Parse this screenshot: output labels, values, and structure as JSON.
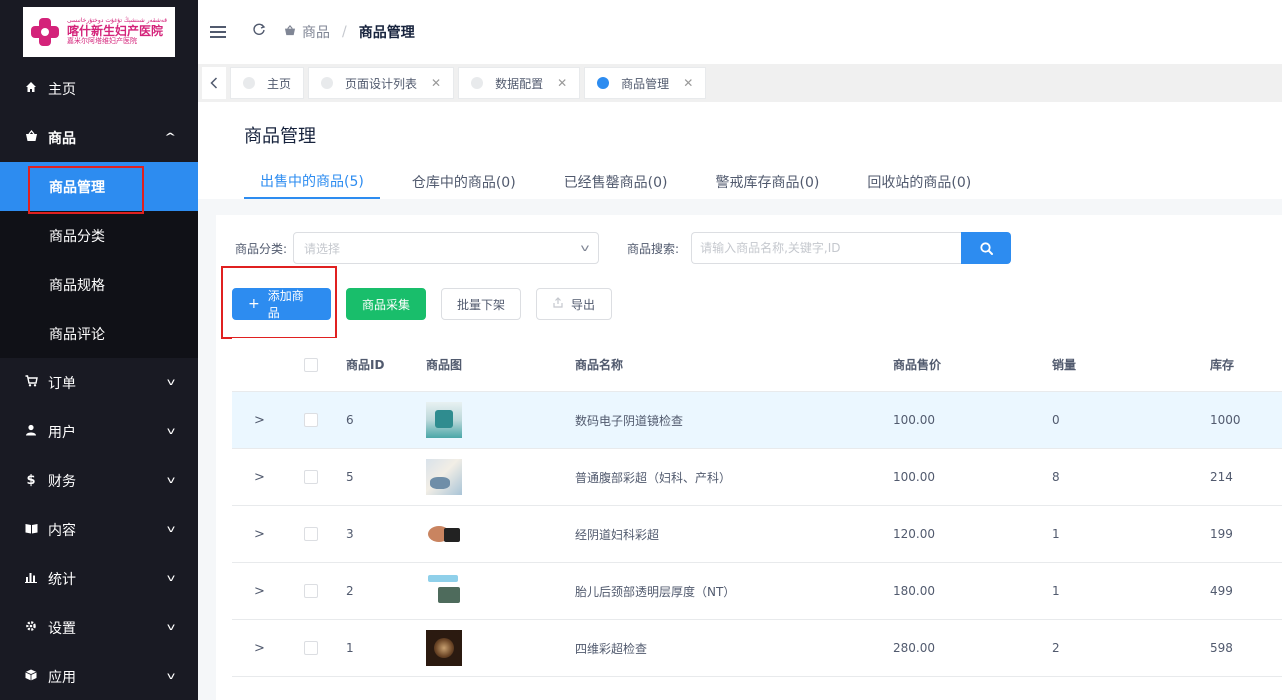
{
  "logo": {
    "main_text": "喀什新生妇产医院",
    "sub_text": "嘉米尔阿塔维妇产医院",
    "script_text": "قەشقەر شىنشېڭ تۇغۇت دوختۇرخانىسى"
  },
  "sidebar": {
    "items": [
      {
        "label": "主页",
        "icon": "home-icon"
      },
      {
        "label": "商品",
        "icon": "basket-icon",
        "open": true,
        "children": [
          {
            "label": "商品管理",
            "active": true
          },
          {
            "label": "商品分类"
          },
          {
            "label": "商品规格"
          },
          {
            "label": "商品评论"
          }
        ]
      },
      {
        "label": "订单",
        "icon": "cart-icon"
      },
      {
        "label": "用户",
        "icon": "user-icon"
      },
      {
        "label": "财务",
        "icon": "dollar-icon"
      },
      {
        "label": "内容",
        "icon": "book-icon"
      },
      {
        "label": "统计",
        "icon": "bar-chart-icon"
      },
      {
        "label": "设置",
        "icon": "gear-icon"
      },
      {
        "label": "应用",
        "icon": "cube-icon"
      }
    ]
  },
  "header": {
    "breadcrumb": [
      "商品",
      "商品管理"
    ],
    "separator": "/"
  },
  "page_tabs": [
    {
      "label": "主页",
      "closable": false,
      "active": false
    },
    {
      "label": "页面设计列表",
      "closable": true,
      "active": false
    },
    {
      "label": "数据配置",
      "closable": true,
      "active": false
    },
    {
      "label": "商品管理",
      "closable": true,
      "active": true
    }
  ],
  "main": {
    "title": "商品管理",
    "product_tabs": [
      {
        "label": "出售中的商品(5)",
        "active": true
      },
      {
        "label": "仓库中的商品(0)"
      },
      {
        "label": "已经售罄商品(0)"
      },
      {
        "label": "警戒库存商品(0)"
      },
      {
        "label": "回收站的商品(0)"
      }
    ],
    "filter": {
      "category_label": "商品分类:",
      "category_placeholder": "请选择",
      "search_label": "商品搜索:",
      "search_placeholder": "请输入商品名称,关键字,ID"
    },
    "buttons": {
      "add": "添加商品",
      "collect": "商品采集",
      "batch_off": "批量下架",
      "export": "导出"
    },
    "table": {
      "columns": [
        "商品ID",
        "商品图",
        "商品名称",
        "商品售价",
        "销量",
        "库存"
      ],
      "rows": [
        {
          "id": "6",
          "name": "数码电子阴道镜检查",
          "price": "100.00",
          "sales": "0",
          "stock": "1000"
        },
        {
          "id": "5",
          "name": "普通腹部彩超（妇科、产科）",
          "price": "100.00",
          "sales": "8",
          "stock": "214"
        },
        {
          "id": "3",
          "name": "经阴道妇科彩超",
          "price": "120.00",
          "sales": "1",
          "stock": "199"
        },
        {
          "id": "2",
          "name": "胎儿后颈部透明层厚度（NT）",
          "price": "180.00",
          "sales": "1",
          "stock": "499"
        },
        {
          "id": "1",
          "name": "四维彩超检查",
          "price": "280.00",
          "sales": "2",
          "stock": "598"
        }
      ]
    }
  },
  "colors": {
    "primary": "#2d8cf0",
    "success": "#19be6b",
    "sidebar_bg": "#191a23",
    "highlight_box": "#e02020"
  }
}
